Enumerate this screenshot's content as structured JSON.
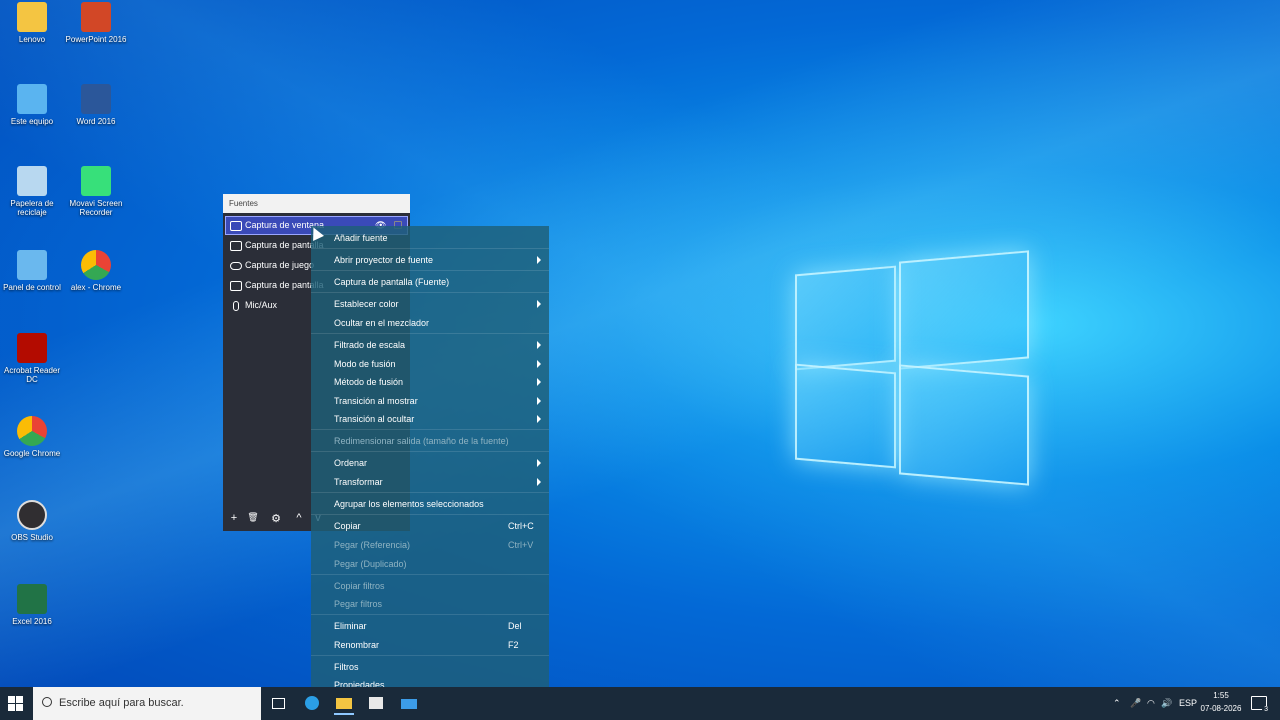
{
  "desktop_icons": [
    {
      "label": "Lenovo",
      "icon": "user-folder-icon",
      "color": "#f4c542"
    },
    {
      "label": "PowerPoint 2016",
      "icon": "powerpoint-icon",
      "color": "#d24726"
    },
    {
      "label": "Este equipo",
      "icon": "computer-icon",
      "color": "#5ab4f0"
    },
    {
      "label": "Word 2016",
      "icon": "word-icon",
      "color": "#2b579a"
    },
    {
      "label": "Papelera de reciclaje",
      "icon": "recycle-bin-icon",
      "color": "#b8d8f0"
    },
    {
      "label": "Movavi Screen Recorder",
      "icon": "movavi-icon",
      "color": "#37e07a"
    },
    {
      "label": "Panel de control",
      "icon": "control-panel-icon",
      "color": "#6ab8ee"
    },
    {
      "label": "alex - Chrome",
      "icon": "chrome-icon",
      "color": "#e74c3c"
    },
    {
      "label": "Acrobat Reader DC",
      "icon": "acrobat-icon",
      "color": "#b30b00"
    },
    {
      "label": "Google Chrome",
      "icon": "chrome-icon",
      "color": "#4285f4"
    },
    {
      "label": "OBS Studio",
      "icon": "obs-icon",
      "color": "#302e31"
    },
    {
      "label": "Excel 2016",
      "icon": "excel-icon",
      "color": "#217346"
    }
  ],
  "fuentes": {
    "title": "Fuentes",
    "sources": [
      {
        "label": "Captura de ventana",
        "icon": "window-capture-icon",
        "selected": true
      },
      {
        "label": "Captura de pantalla",
        "icon": "display-capture-icon"
      },
      {
        "label": "Captura de juego",
        "icon": "gamepad-icon"
      },
      {
        "label": "Captura de pantalla",
        "icon": "display-capture-icon"
      },
      {
        "label": "Mic/Aux",
        "icon": "microphone-icon"
      }
    ],
    "toolbar": [
      "+",
      "🗑",
      "⚙",
      "^",
      "v"
    ]
  },
  "context_menu": {
    "items": [
      {
        "label": "Añadir fuente"
      },
      {
        "label": "Abrir proyector de fuente",
        "submenu": true
      },
      {
        "label": "Captura de pantalla (Fuente)"
      },
      {
        "label": "Establecer color",
        "submenu": true
      },
      {
        "label": "Ocultar en el mezclador"
      },
      {
        "label": "Filtrado de escala",
        "submenu": true
      },
      {
        "label": "Modo de fusión",
        "submenu": true
      },
      {
        "label": "Método de fusión",
        "submenu": true
      },
      {
        "label": "Transición al mostrar",
        "submenu": true
      },
      {
        "label": "Transición al ocultar",
        "submenu": true
      },
      {
        "label": "Redimensionar salida (tamaño de la fuente)",
        "disabled": true
      },
      {
        "label": "Ordenar",
        "submenu": true
      },
      {
        "label": "Transformar",
        "submenu": true
      },
      {
        "label": "Agrupar los elementos seleccionados"
      },
      {
        "label": "Copiar",
        "shortcut": "Ctrl+C"
      },
      {
        "label": "Pegar (Referencia)",
        "shortcut": "Ctrl+V",
        "disabled": true
      },
      {
        "label": "Pegar (Duplicado)",
        "disabled": true
      },
      {
        "label": "Copiar filtros",
        "disabled": true
      },
      {
        "label": "Pegar filtros",
        "disabled": true
      },
      {
        "label": "Eliminar",
        "shortcut": "Del"
      },
      {
        "label": "Renombrar",
        "shortcut": "F2"
      },
      {
        "label": "Filtros"
      },
      {
        "label": "Propiedades"
      }
    ]
  },
  "taskbar": {
    "search_placeholder": "Escribe aquí para buscar.",
    "language": "ESP",
    "time": "1:55",
    "date": "07-08-2026",
    "notification_count": "3"
  }
}
